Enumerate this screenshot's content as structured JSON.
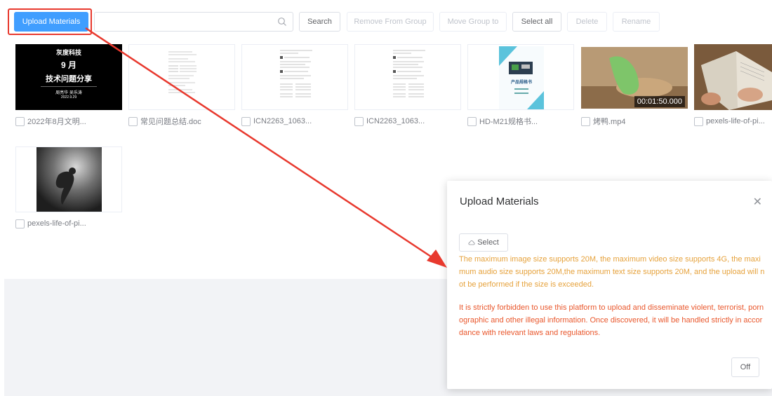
{
  "toolbar": {
    "upload_label": "Upload Materials",
    "search_placeholder": "",
    "search_label": "Search",
    "remove_label": "Remove From Group",
    "move_label": "Move Group to",
    "select_all_label": "Select all",
    "delete_label": "Delete",
    "rename_label": "Rename"
  },
  "materials": [
    {
      "name": "2022年8月文明...",
      "kind": "slide",
      "slide_lines": [
        "灰度科技",
        "9 月",
        "技术问题分享",
        "周亮华 吴乐涛",
        "2022.9.29"
      ]
    },
    {
      "name": "常见问题总结.doc",
      "kind": "document"
    },
    {
      "name": "ICN2263_1063...",
      "kind": "document"
    },
    {
      "name": "ICN2263_1063...",
      "kind": "document"
    },
    {
      "name": "HD-M21规格书...",
      "kind": "spec",
      "cover_title": "产品规格书"
    },
    {
      "name": "烤鸭.mp4",
      "kind": "video",
      "duration": "00:01:50.000"
    },
    {
      "name": "pexels-life-of-pi...",
      "kind": "photo-book"
    },
    {
      "name": "pexels-life-of-pi...",
      "kind": "photo-swimmer"
    }
  ],
  "dialog": {
    "title": "Upload Materials",
    "select_label": "Select",
    "notice_size": "The maximum image size supports 20M, the maximum video size supports 4G, the maximum audio size supports 20M,the maximum text size supports 20M, and the upload will not be performed if the size is exceeded.",
    "notice_legal": "It is strictly forbidden to use this platform to upload and disseminate violent, terrorist, pornographic and other illegal information. Once discovered, it will be handled strictly in accordance with relevant laws and regulations.",
    "off_label": "Off"
  },
  "colors": {
    "primary": "#409eff",
    "annotation": "#e8392e",
    "warning": "#e6a23c",
    "danger": "#e9572c"
  }
}
